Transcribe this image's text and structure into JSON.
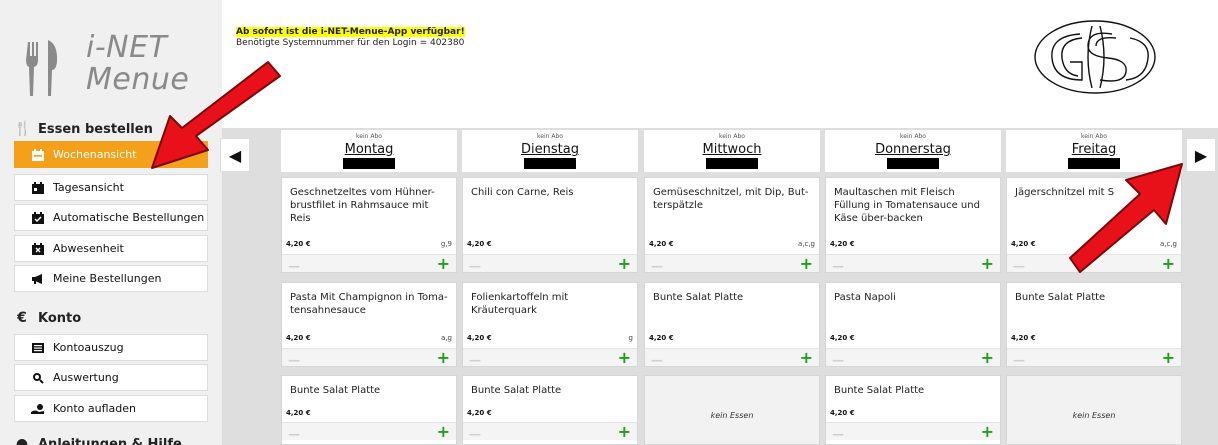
{
  "sidebar": {
    "logo": {
      "line1": "i-NET",
      "line2": "Menue"
    },
    "sections": {
      "essen": "Essen bestellen",
      "konto": "Konto",
      "anleitung": "Anleitungen & Hilfe"
    },
    "items": [
      {
        "label": "Wochenansicht",
        "icon": "calendar-week-icon",
        "active": true
      },
      {
        "label": "Tagesansicht",
        "icon": "calendar-day-icon"
      },
      {
        "label": "Automatische Bestellungen",
        "icon": "calendar-check-icon"
      },
      {
        "label": "Abwesenheit",
        "icon": "calendar-x-icon"
      },
      {
        "label": "Meine Bestellungen",
        "icon": "bullhorn-icon"
      },
      {
        "label": "Kontoauszug",
        "icon": "list-icon"
      },
      {
        "label": "Auswertung",
        "icon": "magnifier-icon"
      },
      {
        "label": "Konto aufladen",
        "icon": "hand-coins-icon"
      }
    ]
  },
  "header": {
    "notice_highlight": "Ab sofort ist die i-NET-Menue-App verfügbar!",
    "notice_line2": "Benötigte Systemnummer für den Login = 402380"
  },
  "days": [
    {
      "abo": "kein Abo",
      "name": "Montag"
    },
    {
      "abo": "kein Abo",
      "name": "Dienstag"
    },
    {
      "abo": "kein Abo",
      "name": "Mittwoch"
    },
    {
      "abo": "kein Abo",
      "name": "Donnerstag"
    },
    {
      "abo": "kein Abo",
      "name": "Freitag"
    }
  ],
  "menu": {
    "row1": [
      {
        "title": "Geschnetzeltes vom Hühner-brustfilet in Rahmsauce mit Reis",
        "price": "4,20 €",
        "allerg": "g,9"
      },
      {
        "title": "Chili con Carne, Reis",
        "price": "4,20 €",
        "allerg": ""
      },
      {
        "title": "Gemüseschnitzel, mit Dip, But-terspätzle",
        "price": "4,20 €",
        "allerg": "a,c,g"
      },
      {
        "title": "Maultaschen mit Fleisch Füllung in Tomatensauce und Käse über-backen",
        "price": "4,20 €",
        "allerg": ""
      },
      {
        "title": "Jägerschnitzel mit S",
        "price": "4,20 €",
        "allerg": "a,c,g"
      }
    ],
    "row2": [
      {
        "title": "Pasta Mit Champignon in Toma-tensahnesauce",
        "price": "4,20 €",
        "allerg": "a,g"
      },
      {
        "title": "Folienkartoffeln mit Kräuterquark",
        "price": "4,20 €",
        "allerg": "g"
      },
      {
        "title": "Bunte Salat Platte",
        "price": "4,20 €",
        "allerg": ""
      },
      {
        "title": "Pasta Napoli",
        "price": "4,20 €",
        "allerg": ""
      },
      {
        "title": "Bunte Salat Platte",
        "price": "4,20 €",
        "allerg": ""
      }
    ],
    "row3": [
      {
        "title": "Bunte Salat Platte",
        "price": "4,20 €"
      },
      {
        "title": "Bunte Salat Platte",
        "price": "4,20 €"
      },
      {
        "none": "kein Essen"
      },
      {
        "title": "Bunte Salat Platte",
        "price": "4,20 €"
      },
      {
        "none": "kein Essen"
      }
    ]
  },
  "controls": {
    "minus": "—",
    "plus": "+"
  },
  "colors": {
    "active": "#f5a01a",
    "plus": "#1f9e1f",
    "annotation": "#e8111a"
  }
}
